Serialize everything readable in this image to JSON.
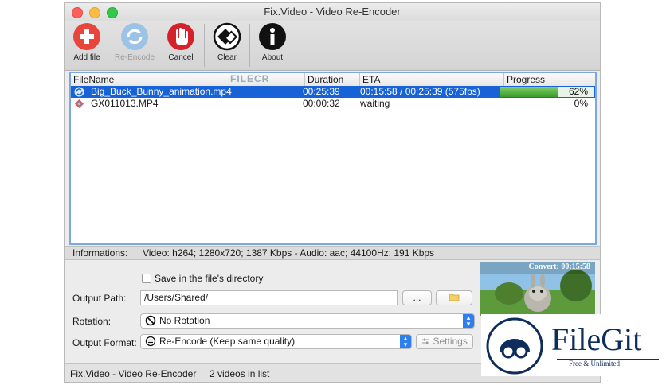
{
  "window": {
    "title": "Fix.Video - Video Re-Encoder"
  },
  "toolbar": {
    "add_file": "Add file",
    "re_encode": "Re-Encode",
    "cancel": "Cancel",
    "clear": "Clear",
    "about": "About"
  },
  "table": {
    "columns": [
      "FileName",
      "Duration",
      "ETA",
      "Progress"
    ],
    "rows": [
      {
        "filename": "Big_Buck_Bunny_animation.mp4",
        "duration": "00:25:39",
        "eta": "00:15:58 / 00:25:39 (575fps)",
        "progress": "62%",
        "progress_value": 0.62,
        "selected": true
      },
      {
        "filename": "GX011013.MP4",
        "duration": "00:00:32",
        "eta": "waiting",
        "progress": "0%",
        "progress_value": 0,
        "selected": false
      }
    ],
    "watermark": "FILECR"
  },
  "info": {
    "label": "Informations:",
    "value": "Video: h264; 1280x720; 1387 Kbps - Audio: aac; 44100Hz; 191 Kbps"
  },
  "options": {
    "save_in_dir": "Save in the file's directory",
    "output_path_label": "Output Path:",
    "output_path_value": "/Users/Shared/",
    "browse_label": "...",
    "rotation_label": "Rotation:",
    "rotation_value": "No Rotation",
    "output_format_label": "Output Format:",
    "output_format_value": "Re-Encode (Keep same quality)",
    "settings_label": "Settings"
  },
  "preview": {
    "caption": "Convert: 00:15:58"
  },
  "status": {
    "app": "Fix.Video - Video Re-Encoder",
    "count": "2 videos in list"
  },
  "badge": {
    "brand": "FileGit",
    "tagline": "Free & Unlimited"
  },
  "colors": {
    "selection": "#1662d6",
    "progress": "#3c9b2a",
    "brand": "#0f2d5c"
  }
}
